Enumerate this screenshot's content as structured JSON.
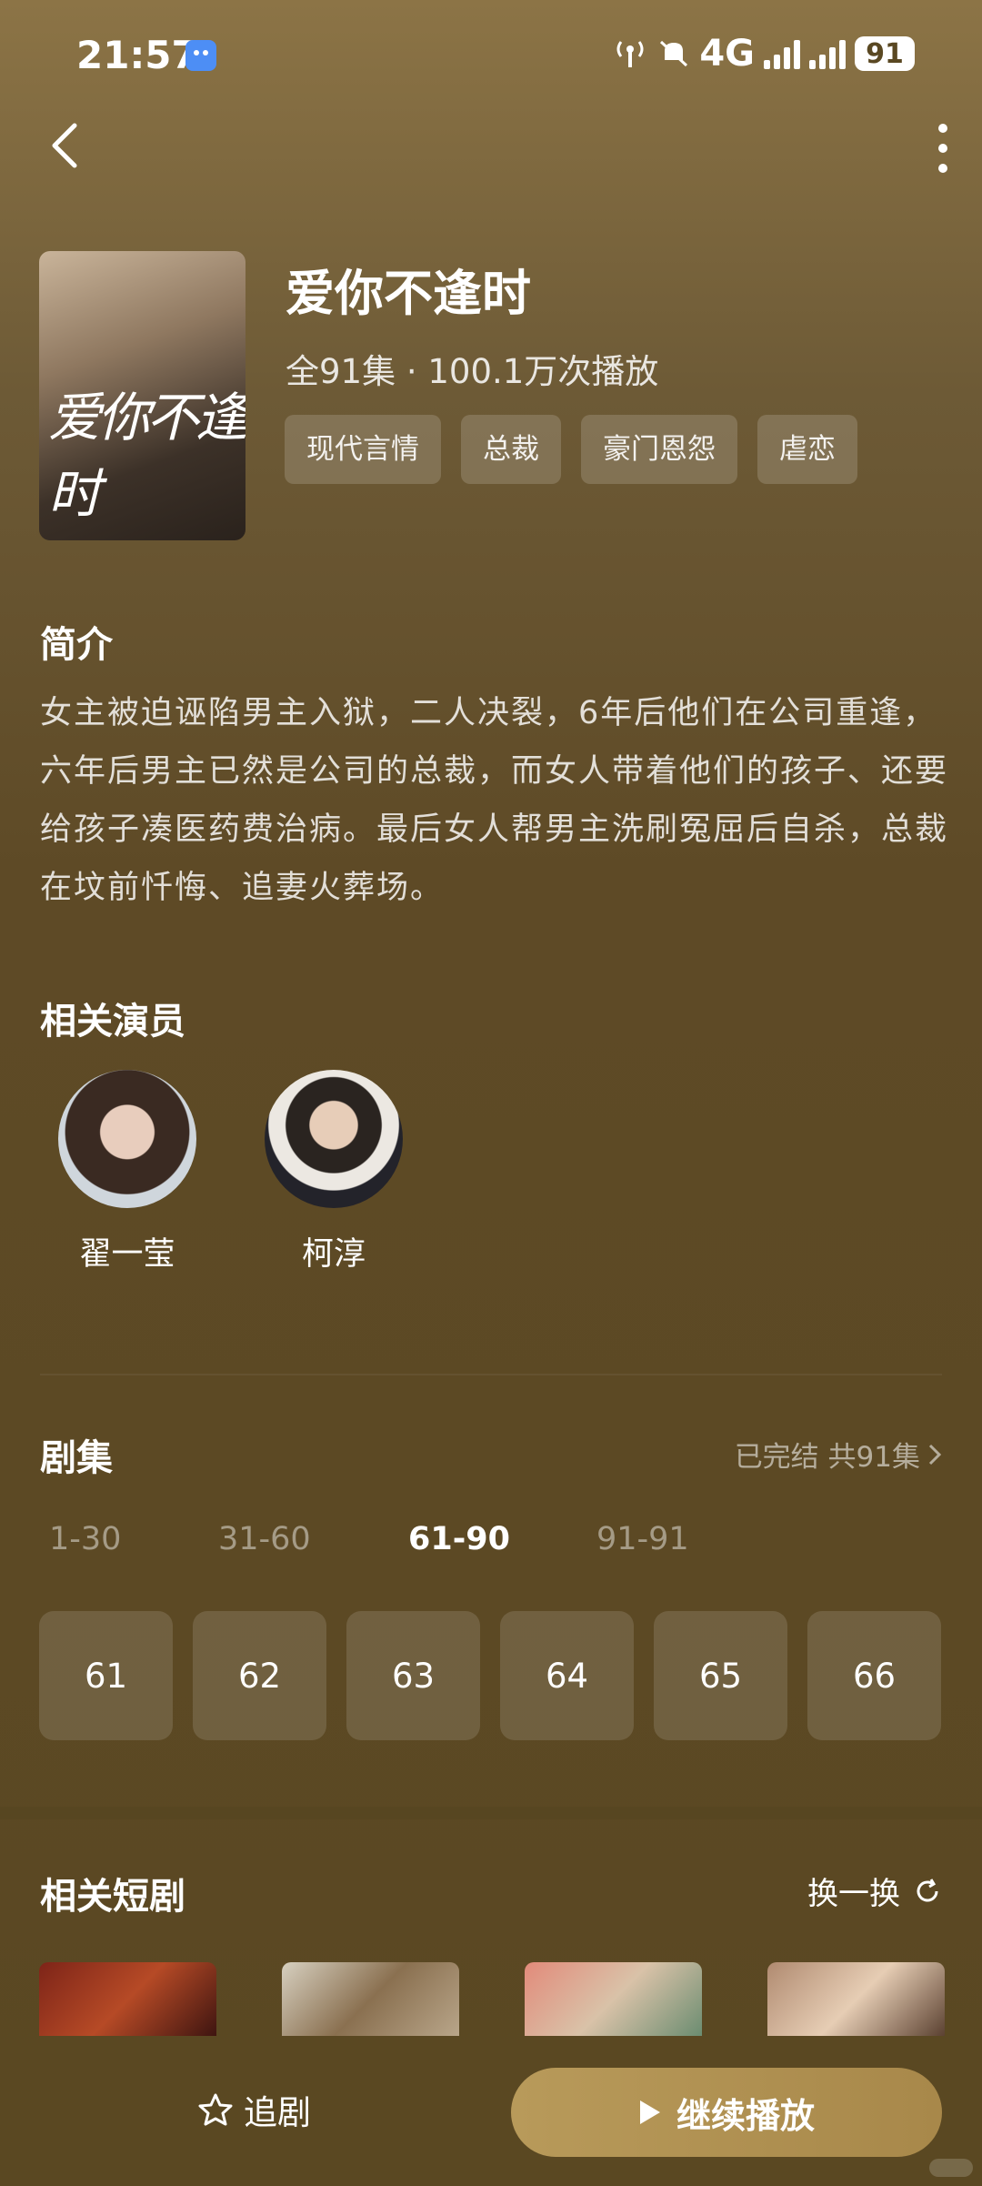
{
  "status_bar": {
    "time": "21:57",
    "network": "4G",
    "battery": "91"
  },
  "drama": {
    "poster_text": "爱你不逢时",
    "title": "爱你不逢时",
    "meta": "全91集 · 100.1万次播放",
    "tags": [
      "现代言情",
      "总裁",
      "豪门恩怨",
      "虐恋"
    ]
  },
  "intro": {
    "title": "简介",
    "text": "女主被迫诬陷男主入狱，二人决裂，6年后他们在公司重逢，六年后男主已然是公司的总裁，而女人带着他们的孩子、还要给孩子凑医药费治病。最后女人帮男主洗刷冤屈后自杀，总裁在坟前忏悔、追妻火葬场。"
  },
  "actors": {
    "title": "相关演员",
    "items": [
      {
        "name": "翟一莹"
      },
      {
        "name": "柯淳"
      }
    ]
  },
  "episodes": {
    "title": "剧集",
    "status": "已完结 共91集",
    "ranges": [
      "1-30",
      "31-60",
      "61-90",
      "91-91"
    ],
    "active_range": "61-90",
    "items": [
      "61",
      "62",
      "63",
      "64",
      "65",
      "66"
    ]
  },
  "related": {
    "title": "相关短剧",
    "refresh_label": "换一换"
  },
  "bottom_bar": {
    "follow_label": "追剧",
    "play_label": "继续播放"
  },
  "colors": {
    "background": "#5a4822",
    "accent": "#b89a5a"
  },
  "icons": [
    "back-icon",
    "more-icon",
    "chevron-right-icon",
    "refresh-icon",
    "star-icon",
    "play-icon"
  ]
}
